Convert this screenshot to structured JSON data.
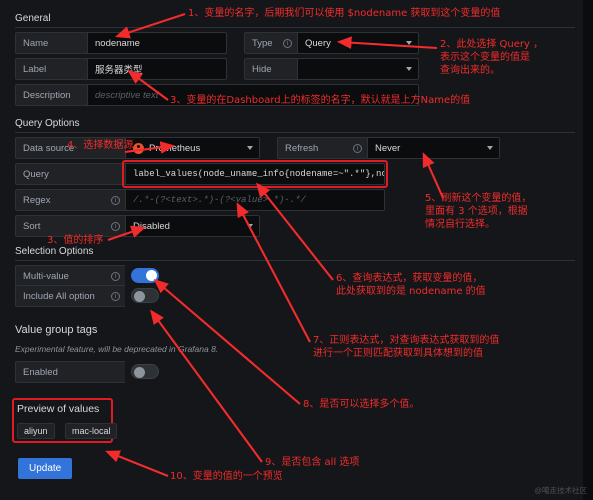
{
  "sections": {
    "general": "General",
    "query_options": "Query Options",
    "selection_options": "Selection Options",
    "value_group_tags": "Value group tags",
    "preview_of_values": "Preview of values"
  },
  "general": {
    "name_label": "Name",
    "name_value": "nodename",
    "type_label": "Type",
    "type_value": "Query",
    "label_label": "Label",
    "label_value": "服务器类型",
    "hide_label": "Hide",
    "hide_value": "",
    "description_label": "Description",
    "description_placeholder": "descriptive text"
  },
  "query_options": {
    "datasource_label": "Data source",
    "datasource_value": "Prometheus",
    "refresh_label": "Refresh",
    "refresh_value": "Never",
    "query_label": "Query",
    "query_value": "label_values(node_uname_info{nodename=~\".*\"},nodename)",
    "regex_label": "Regex",
    "regex_placeholder": "/.*-(?<text>.*)-(?<value>.*)-.*/",
    "sort_label": "Sort",
    "sort_value": "Disabled"
  },
  "selection_options": {
    "multi_value_label": "Multi-value",
    "multi_value_on": true,
    "include_all_label": "Include All option",
    "include_all_on": false
  },
  "value_group_tags": {
    "note": "Experimental feature, will be deprecated in Grafana 8.",
    "enabled_label": "Enabled",
    "enabled_on": false
  },
  "preview": {
    "values": [
      "aliyun",
      "mac-local"
    ]
  },
  "actions": {
    "update_label": "Update"
  },
  "annotations": [
    {
      "id": 1,
      "text": "1、变量的名字，后期我们可以使用 $nodename 获取到这个变量的值"
    },
    {
      "id": 2,
      "text": "2、此处选择 Query ，\n表示这个变量的值是\n查询出来的。"
    },
    {
      "id": 3,
      "text": "3、变量的在Dashboard上的标签的名字，默认就是上方Name的值"
    },
    {
      "id": 4,
      "text": "4、选择数据源"
    },
    {
      "id": 5,
      "text": "5、刷新这个变量的值，\n里面有 3 个选项，根据\n情况自行选择。"
    },
    {
      "id": 6,
      "text": "6、查询表达式，获取变量的值，\n此处获取到的是 nodename 的值"
    },
    {
      "id": 7,
      "text": "7、正则表达式，对查询表达式获取到的值\n进行一个正则匹配获取到具体想到的值"
    },
    {
      "id": 8,
      "text": "8、是否可以选择多个值。"
    },
    {
      "id": 9,
      "text": "9、是否包含 all 选项"
    },
    {
      "id": 10,
      "text": "10、变量的值的一个预览"
    },
    {
      "id": 11,
      "text": "3、值的排序"
    }
  ],
  "watermark": "@噶走技术社区"
}
